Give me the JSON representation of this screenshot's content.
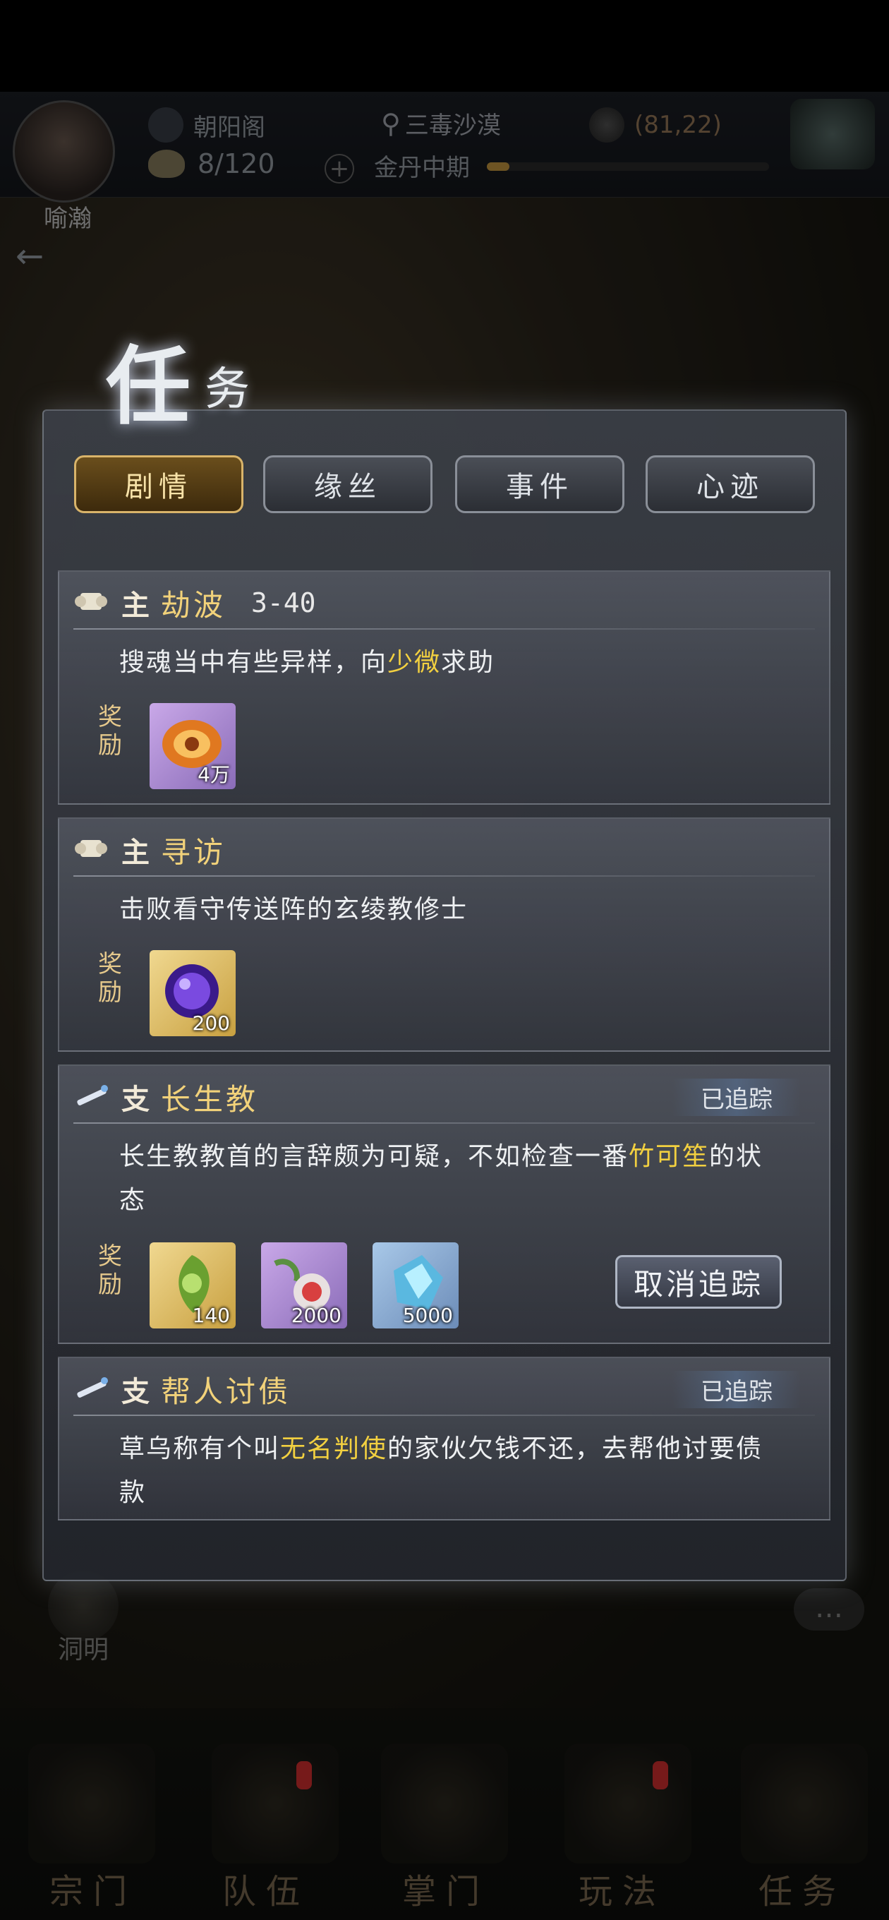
{
  "hud": {
    "player_name": "喻瀚",
    "sect": "朝阳阁",
    "location": "三毒沙漠",
    "coord": "(81,22)",
    "stamina": "8/120",
    "realm": "金丹中期",
    "exp_progress": 0.08
  },
  "panel": {
    "title_big": "任",
    "title_small": "务"
  },
  "tabs": [
    {
      "label": "剧情",
      "active": true
    },
    {
      "label": "缘丝",
      "active": false
    },
    {
      "label": "事件",
      "active": false
    },
    {
      "label": "心迹",
      "active": false
    }
  ],
  "quests": [
    {
      "type": "主",
      "name": "劫波",
      "level": "3-40",
      "desc_pre": "搜魂当中有些异样，向",
      "desc_hl": "少微",
      "desc_post": "求助",
      "reward_label": "奖励",
      "rewards": [
        {
          "icon": "amber-orb-icon",
          "qty": "4万"
        }
      ]
    },
    {
      "type": "主",
      "name": "寻访",
      "desc_pre": "击败看守传送阵的玄绫教修士",
      "desc_hl": "",
      "desc_post": "",
      "reward_label": "奖励",
      "rewards": [
        {
          "icon": "purple-orb-icon",
          "qty": "200"
        }
      ]
    },
    {
      "type": "支",
      "name": "长生教",
      "tracked": "已追踪",
      "desc_pre": "长生教教首的言辞颇为可疑，不如检查一番",
      "desc_hl": "竹可笙",
      "desc_post": "的状态",
      "reward_label": "奖励",
      "rewards": [
        {
          "icon": "green-jade-icon",
          "qty": "140"
        },
        {
          "icon": "herb-pill-icon",
          "qty": "2000"
        },
        {
          "icon": "blue-crystal-icon",
          "qty": "5000"
        }
      ],
      "untrack_label": "取消追踪"
    },
    {
      "type": "支",
      "name": "帮人讨债",
      "tracked": "已追踪",
      "desc_pre": "草乌称有个叫",
      "desc_hl": "无名判使",
      "desc_post": "的家伙欠钱不还，去帮他讨要债款"
    }
  ],
  "bottom_nav": [
    "宗门",
    "队伍",
    "掌门",
    "玩法",
    "任务"
  ],
  "side_button": "洞明",
  "colors": {
    "highlight": "#f2d040",
    "quest_name": "#f2d27a",
    "active_tab": "#d9b46a"
  }
}
